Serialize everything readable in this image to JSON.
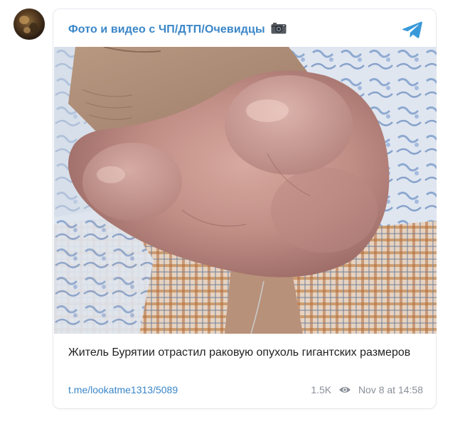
{
  "post": {
    "channel_name": "Фото и видео с ЧП/ДТП/Очевидцы",
    "channel_icon": "camera-emoji",
    "share_icon": "telegram-icon",
    "avatar_icon": "channel-avatar",
    "photo_description": "photo",
    "caption": "Житель Бурятии отрастил раковую опухоль гигантских размеров",
    "link": "t.me/lookatme1313/5089",
    "views": "1.5K",
    "views_icon": "eye-icon",
    "timestamp": "Nov 8 at 14:58"
  },
  "colors": {
    "accent": "#3a86c8",
    "muted": "#8a9099",
    "text": "#222222"
  }
}
